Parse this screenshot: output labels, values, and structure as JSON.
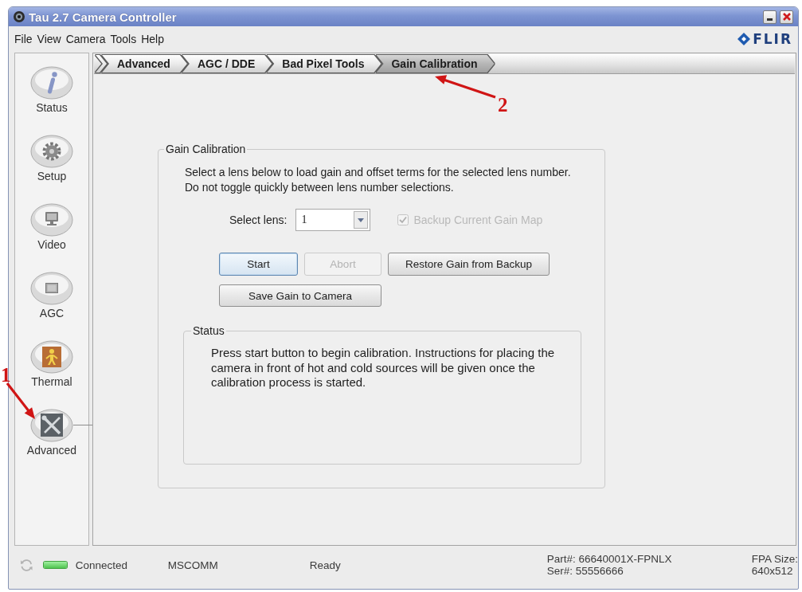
{
  "window": {
    "title": "Tau 2.7 Camera Controller"
  },
  "menu": [
    {
      "label": "File"
    },
    {
      "label": "View"
    },
    {
      "label": "Camera"
    },
    {
      "label": "Tools"
    },
    {
      "label": "Help"
    }
  ],
  "brand": "FLIR",
  "sidebar": {
    "items": [
      {
        "label": "Status",
        "kind": "info",
        "selected": false
      },
      {
        "label": "Setup",
        "kind": "gear",
        "selected": false
      },
      {
        "label": "Video",
        "kind": "monitor",
        "selected": false
      },
      {
        "label": "AGC",
        "kind": "screen",
        "selected": false
      },
      {
        "label": "Thermal",
        "kind": "thermal",
        "selected": false
      },
      {
        "label": "Advanced",
        "kind": "tools",
        "selected": true
      }
    ]
  },
  "breadcrumb": [
    {
      "label": "Advanced",
      "selected": false
    },
    {
      "label": "AGC / DDE",
      "selected": false
    },
    {
      "label": "Bad Pixel Tools",
      "selected": false
    },
    {
      "label": "Gain Calibration",
      "selected": true
    }
  ],
  "gain_calibration": {
    "title": "Gain Calibration",
    "instructions": [
      "Select a lens below to load gain and offset terms for the selected lens number.",
      "Do not toggle quickly between lens number selections."
    ],
    "lens": {
      "label": "Select lens:",
      "value": "1"
    },
    "backup": {
      "label": "Backup Current Gain Map",
      "checked": true,
      "disabled": true
    },
    "buttons": [
      {
        "label": "Start",
        "disabled": false,
        "focused": true
      },
      {
        "label": "Abort",
        "disabled": true,
        "focused": false
      },
      {
        "label": "Restore Gain from Backup",
        "disabled": false,
        "focused": false
      },
      {
        "label": "Save Gain to Camera",
        "disabled": false,
        "focused": false
      }
    ],
    "status": {
      "title": "Status",
      "message": "Press start button to begin calibration. Instructions for placing the camera in front of hot and cold sources will be given once the calibration process is started."
    }
  },
  "status_bar": {
    "connected": true,
    "connection": "Connected",
    "port": "MSCOMM",
    "state": "Ready",
    "part": "Part#: 66640001X-FPNLX",
    "serial": "Ser#: 55556666",
    "fpa_label": "FPA Size:",
    "fpa_value": "640x512"
  },
  "annotations": [
    {
      "label": "1"
    },
    {
      "label": "2"
    }
  ]
}
